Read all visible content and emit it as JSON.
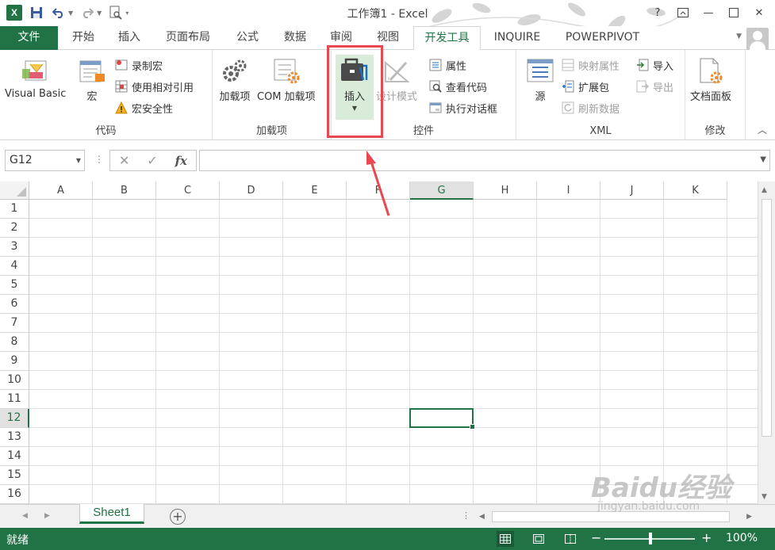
{
  "window": {
    "title": "工作簿1 - Excel"
  },
  "tabs": [
    {
      "label": "文件"
    },
    {
      "label": "开始"
    },
    {
      "label": "插入"
    },
    {
      "label": "页面布局"
    },
    {
      "label": "公式"
    },
    {
      "label": "数据"
    },
    {
      "label": "审阅"
    },
    {
      "label": "视图"
    },
    {
      "label": "开发工具"
    },
    {
      "label": "INQUIRE"
    },
    {
      "label": "POWERPIVOT"
    }
  ],
  "ribbon": {
    "code": {
      "label": "代码",
      "visual_basic": "Visual Basic",
      "macros": "宏",
      "record_macro": "录制宏",
      "relative_ref": "使用相对引用",
      "macro_security": "宏安全性"
    },
    "addins": {
      "label": "加载项",
      "addins": "加载项",
      "com_addins": "COM 加载项"
    },
    "controls": {
      "label": "控件",
      "insert": "插入",
      "design_mode": "设计模式",
      "properties": "属性",
      "view_code": "查看代码",
      "run_dialog": "执行对话框"
    },
    "xml": {
      "label": "XML",
      "source": "源",
      "map_props": "映射属性",
      "expansion": "扩展包",
      "refresh": "刷新数据",
      "import": "导入",
      "export": "导出"
    },
    "modify": {
      "label": "修改",
      "doc_panel": "文档面板"
    }
  },
  "formula_bar": {
    "name_box": "G12",
    "formula": "",
    "fx": "fx"
  },
  "grid": {
    "columns": [
      "A",
      "B",
      "C",
      "D",
      "E",
      "F",
      "G",
      "H",
      "I",
      "J",
      "K"
    ],
    "rows": [
      "1",
      "2",
      "3",
      "4",
      "5",
      "6",
      "7",
      "8",
      "9",
      "10",
      "11",
      "12",
      "13",
      "14",
      "15",
      "16"
    ],
    "selected_column": "G",
    "selected_row": "12"
  },
  "sheets": [
    {
      "name": "Sheet1"
    }
  ],
  "status": {
    "text": "就绪",
    "zoom": "100%"
  },
  "watermark": {
    "line1": "Baidu经验",
    "line2": "jingyan.baidu.com"
  },
  "colors": {
    "accent": "#217346",
    "highlight": "#e8484f"
  }
}
